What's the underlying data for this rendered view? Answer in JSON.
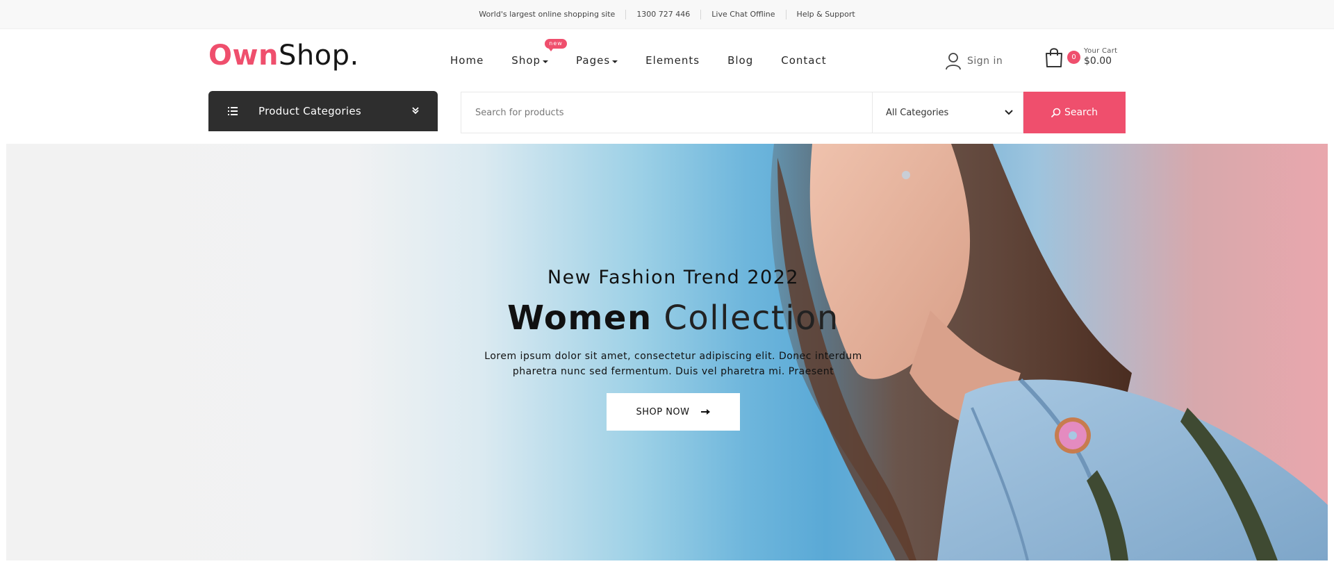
{
  "topbar": {
    "items": [
      "World's largest online shopping site",
      "1300 727 446",
      "Live Chat Offline",
      "Help & Support"
    ]
  },
  "header": {
    "logo": {
      "part1": "Own",
      "part2": "Shop."
    },
    "nav": [
      {
        "label": "Home",
        "has_dropdown": false
      },
      {
        "label": "Shop",
        "has_dropdown": true,
        "badge": "new"
      },
      {
        "label": "Pages",
        "has_dropdown": true
      },
      {
        "label": "Elements",
        "has_dropdown": false
      },
      {
        "label": "Blog",
        "has_dropdown": false
      },
      {
        "label": "Contact",
        "has_dropdown": false
      }
    ],
    "signin_label": "Sign in",
    "cart": {
      "count": "0",
      "label": "Your Cart",
      "total": "$0.00"
    }
  },
  "searchbar": {
    "categories_label": "Product Categories",
    "search_placeholder": "Search for products",
    "search_value": "",
    "category_select": "All Categories",
    "search_button": "Search"
  },
  "hero": {
    "subtitle": "New Fashion Trend 2022",
    "title_bold": "Women",
    "title_light": "Collection",
    "description": "Lorem ipsum dolor sit amet, consectetur adipiscing elit. Donec interdum pharetra nunc sed fermentum. Duis vel pharetra mi. Praesent",
    "button_label": "SHOP NOW"
  },
  "icons": {
    "menu": "list-menu-icon",
    "chevron": "chevron-down-icon",
    "user": "user-icon",
    "cart": "shopping-bag-icon",
    "search": "search-icon",
    "arrow": "arrow-right-icon"
  },
  "colors": {
    "accent": "#ef4f6d",
    "dark": "#2e2e2e",
    "topbar_bg": "#f8f8f8"
  }
}
